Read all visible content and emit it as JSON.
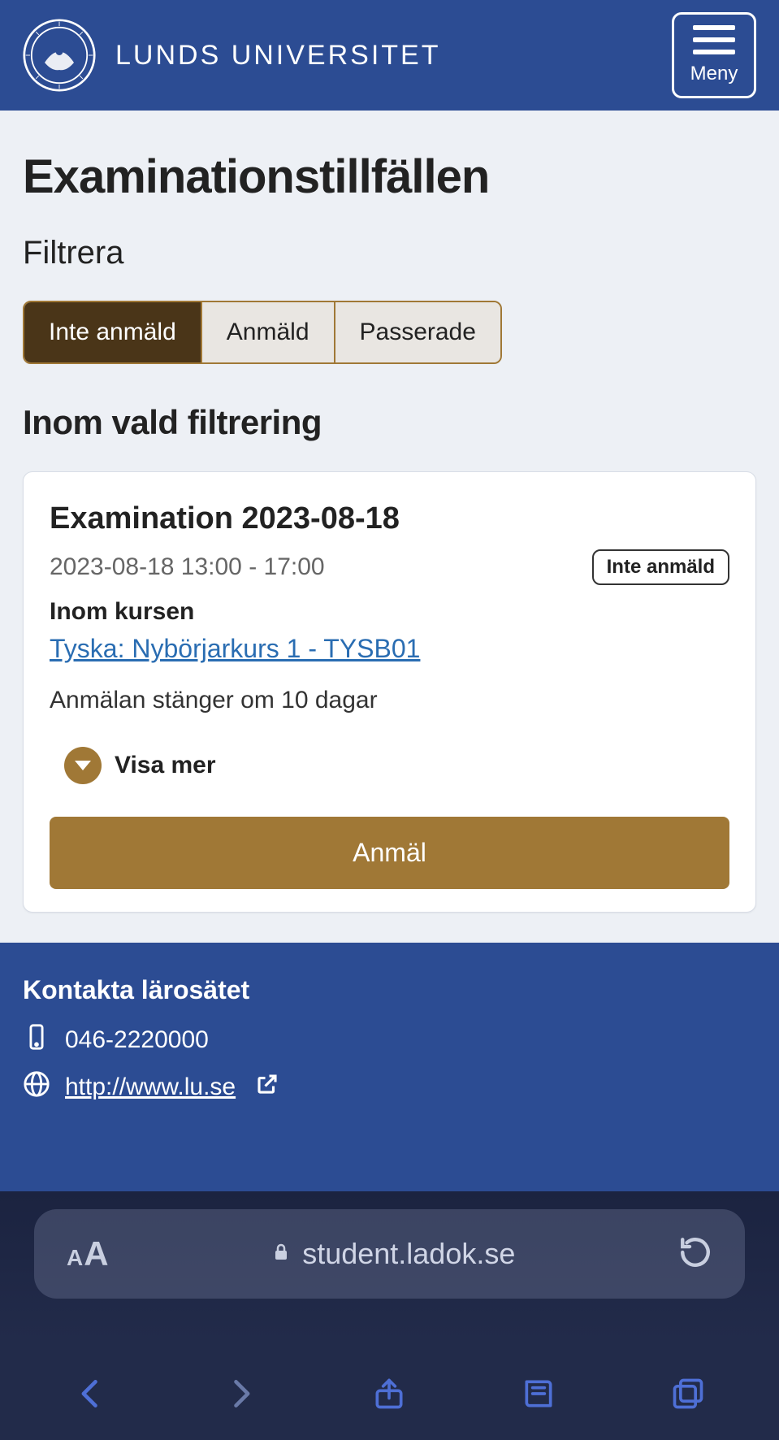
{
  "header": {
    "brand_text": "LUNDS UNIVERSITET",
    "menu_label": "Meny"
  },
  "main": {
    "page_title": "Examinationstillfällen",
    "filter_heading": "Filtrera",
    "tabs": [
      {
        "label": "Inte anmäld",
        "active": true
      },
      {
        "label": "Anmäld",
        "active": false
      },
      {
        "label": "Passerade",
        "active": false
      }
    ],
    "section_heading": "Inom vald filtrering",
    "card": {
      "title": "Examination 2023-08-18",
      "datetime": "2023-08-18 13:00 - 17:00",
      "status_badge": "Inte anmäld",
      "course_label": "Inom kursen",
      "course_link": "Tyska: Nybörjarkurs 1 - TYSB01",
      "deadline_text": "Anmälan stänger om 10 dagar",
      "show_more": "Visa mer",
      "register_button": "Anmäl"
    }
  },
  "footer": {
    "heading": "Kontakta lärosätet",
    "phone": "046-2220000",
    "website": "http://www.lu.se"
  },
  "browser": {
    "url": "student.ladok.se"
  }
}
